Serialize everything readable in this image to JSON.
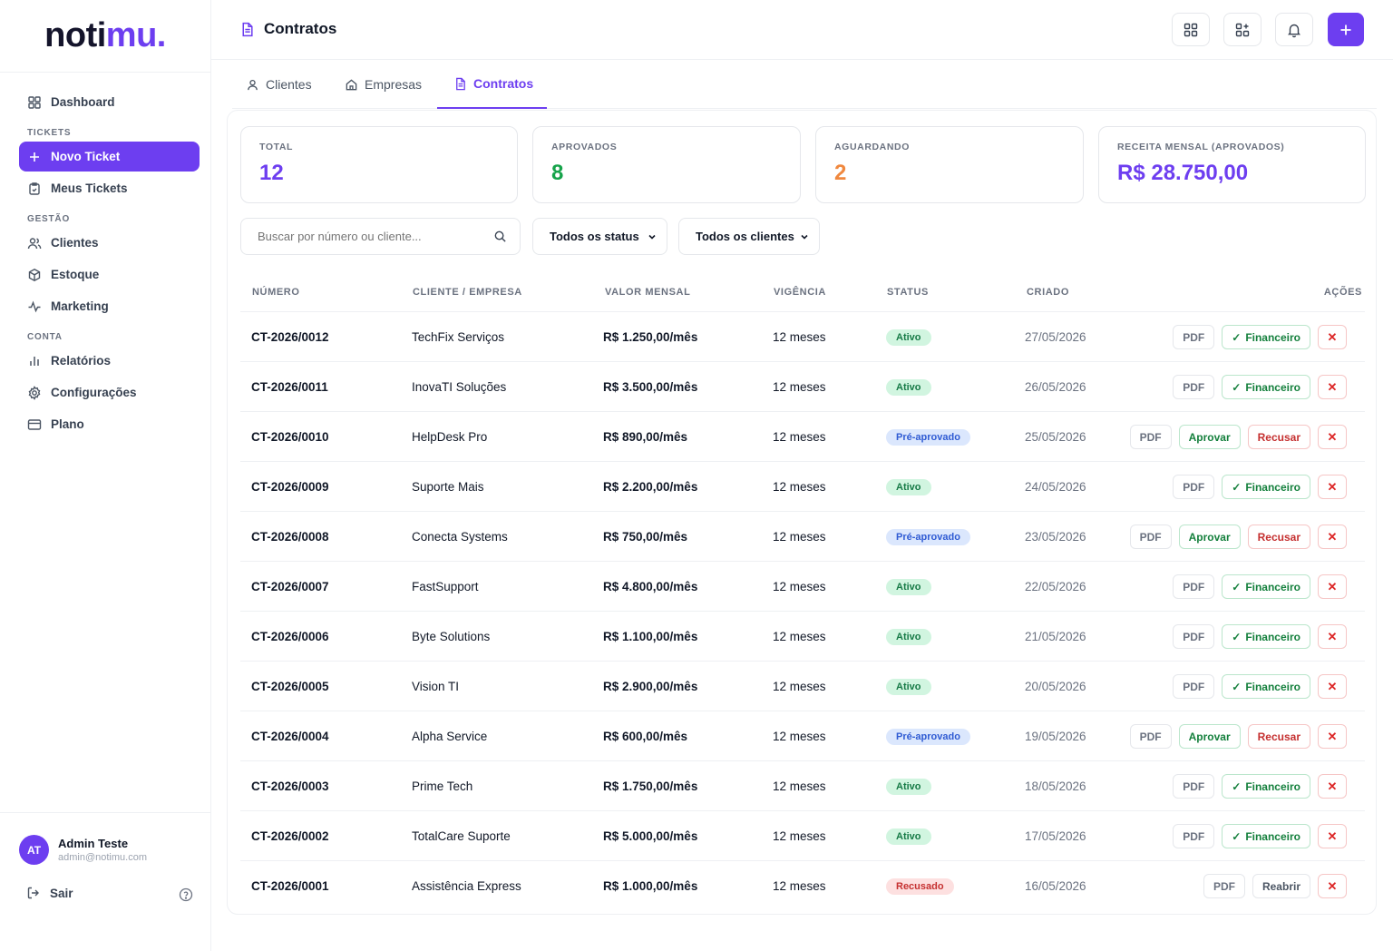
{
  "logo": {
    "part1": "noti",
    "part2": "mu."
  },
  "sidebar": {
    "dashboard": "Dashboard",
    "section_tickets": "TICKETS",
    "novo_ticket": "Novo Ticket",
    "meus_tickets": "Meus Tickets",
    "section_gestao": "GESTÃO",
    "clientes": "Clientes",
    "estoque": "Estoque",
    "marketing": "Marketing",
    "section_conta": "CONTA",
    "relatorios": "Relatórios",
    "configuracoes": "Configurações",
    "plano": "Plano"
  },
  "user": {
    "initials": "AT",
    "name": "Admin Teste",
    "email": "admin@notimu.com",
    "logout": "Sair"
  },
  "header": {
    "title": "Contratos"
  },
  "tabs": {
    "clientes": "Clientes",
    "empresas": "Empresas",
    "contratos": "Contratos"
  },
  "stats": {
    "total_label": "TOTAL",
    "total_value": "12",
    "aprovados_label": "APROVADOS",
    "aprovados_value": "8",
    "aguardando_label": "AGUARDANDO",
    "aguardando_value": "2",
    "receita_label": "RECEITA MENSAL (APROVADOS)",
    "receita_value": "R$ 28.750,00"
  },
  "filters": {
    "search_placeholder": "Buscar por número ou cliente...",
    "status": "Todos os status",
    "clients": "Todos os clientes"
  },
  "table": {
    "headers": {
      "numero": "NÚMERO",
      "cliente": "CLIENTE / EMPRESA",
      "valor": "VALOR MENSAL",
      "vigencia": "VIGÊNCIA",
      "status": "STATUS",
      "criado": "CRIADO",
      "acoes": "AÇÕES"
    },
    "action_labels": {
      "pdf": "PDF",
      "financeiro": "Financeiro",
      "aprovar": "Aprovar",
      "recusar": "Recusar",
      "reabrir": "Reabrir",
      "remove": "✕"
    },
    "rows": [
      {
        "numero": "CT-2026/0012",
        "cliente": "TechFix Serviços",
        "valor": "R$ 1.250,00/mês",
        "vigencia": "12 meses",
        "status": "Ativo",
        "criado": "27/05/2026"
      },
      {
        "numero": "CT-2026/0011",
        "cliente": "InovaTI Soluções",
        "valor": "R$ 3.500,00/mês",
        "vigencia": "12 meses",
        "status": "Ativo",
        "criado": "26/05/2026"
      },
      {
        "numero": "CT-2026/0010",
        "cliente": "HelpDesk Pro",
        "valor": "R$ 890,00/mês",
        "vigencia": "12 meses",
        "status": "Pré-aprovado",
        "criado": "25/05/2026"
      },
      {
        "numero": "CT-2026/0009",
        "cliente": "Suporte Mais",
        "valor": "R$ 2.200,00/mês",
        "vigencia": "12 meses",
        "status": "Ativo",
        "criado": "24/05/2026"
      },
      {
        "numero": "CT-2026/0008",
        "cliente": "Conecta Systems",
        "valor": "R$ 750,00/mês",
        "vigencia": "12 meses",
        "status": "Pré-aprovado",
        "criado": "23/05/2026"
      },
      {
        "numero": "CT-2026/0007",
        "cliente": "FastSupport",
        "valor": "R$ 4.800,00/mês",
        "vigencia": "12 meses",
        "status": "Ativo",
        "criado": "22/05/2026"
      },
      {
        "numero": "CT-2026/0006",
        "cliente": "Byte Solutions",
        "valor": "R$ 1.100,00/mês",
        "vigencia": "12 meses",
        "status": "Ativo",
        "criado": "21/05/2026"
      },
      {
        "numero": "CT-2026/0005",
        "cliente": "Vision TI",
        "valor": "R$ 2.900,00/mês",
        "vigencia": "12 meses",
        "status": "Ativo",
        "criado": "20/05/2026"
      },
      {
        "numero": "CT-2026/0004",
        "cliente": "Alpha Service",
        "valor": "R$ 600,00/mês",
        "vigencia": "12 meses",
        "status": "Pré-aprovado",
        "criado": "19/05/2026"
      },
      {
        "numero": "CT-2026/0003",
        "cliente": "Prime Tech",
        "valor": "R$ 1.750,00/mês",
        "vigencia": "12 meses",
        "status": "Ativo",
        "criado": "18/05/2026"
      },
      {
        "numero": "CT-2026/0002",
        "cliente": "TotalCare Suporte",
        "valor": "R$ 5.000,00/mês",
        "vigencia": "12 meses",
        "status": "Ativo",
        "criado": "17/05/2026"
      },
      {
        "numero": "CT-2026/0001",
        "cliente": "Assistência Express",
        "valor": "R$ 1.000,00/mês",
        "vigencia": "12 meses",
        "status": "Recusado",
        "criado": "16/05/2026"
      }
    ]
  },
  "colors": {
    "accent": "#6d3ef0",
    "aprovados": "#16a34a",
    "aguardando": "#f0883e"
  }
}
